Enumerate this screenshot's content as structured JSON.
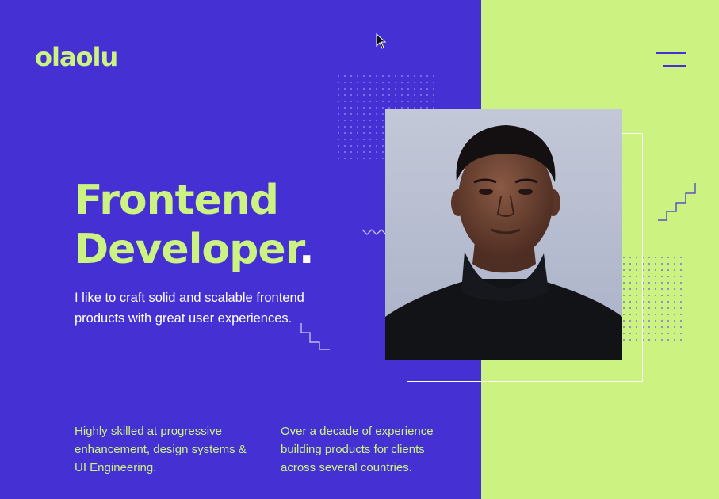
{
  "header": {
    "logo_text": "olaolu",
    "menu_icon": "hamburger-menu-icon"
  },
  "hero": {
    "headline_line1": "Frontend",
    "headline_line2": "Developer",
    "headline_dot": ".",
    "tagline": "I like to craft solid and scalable frontend products with great user experiences."
  },
  "features": [
    {
      "text": "Highly skilled at progressive enhancement, design systems & UI Engineering."
    },
    {
      "text": "Over a decade of experience building products for clients across several countries."
    }
  ],
  "colors": {
    "primary_purple": "#4530d4",
    "accent_lime": "#ccf381",
    "text_white": "#ffffff"
  },
  "portrait": {
    "subject": "portrait-photo"
  }
}
